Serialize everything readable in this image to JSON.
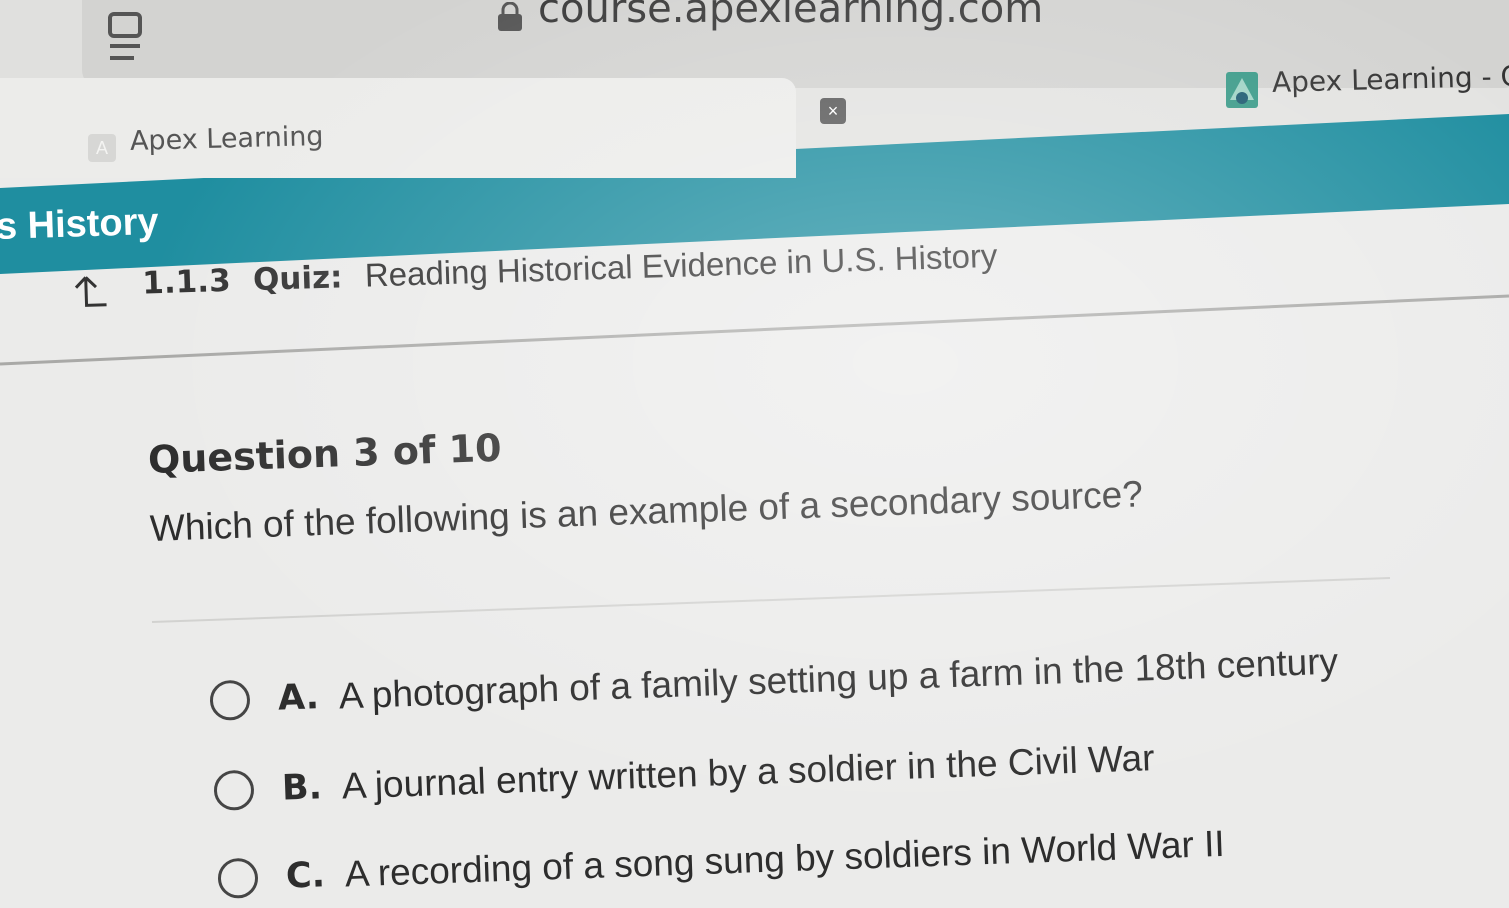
{
  "browser": {
    "url": "course.apexlearning.com",
    "tabs": [
      {
        "label": "Apex Learning",
        "favicon": "A",
        "active": true
      },
      {
        "label": "Apex Learning - C",
        "active": false
      }
    ],
    "close_glyph": "×"
  },
  "course": {
    "title": "s History",
    "band_color": "#1f8ea0"
  },
  "quiz": {
    "number": "1.1.3",
    "label": "Quiz:",
    "title": "Reading Historical Evidence in U.S. History"
  },
  "question": {
    "counter": "Question 3 of 10",
    "text": "Which of the following is an example of a secondary source?",
    "choices": [
      {
        "letter": "A.",
        "text": "A photograph of a family setting up a farm in the 18th century"
      },
      {
        "letter": "B.",
        "text": "A journal entry written by a soldier in the Civil War"
      },
      {
        "letter": "C.",
        "text": "A recording of a song sung by soldiers in World War II"
      }
    ]
  }
}
